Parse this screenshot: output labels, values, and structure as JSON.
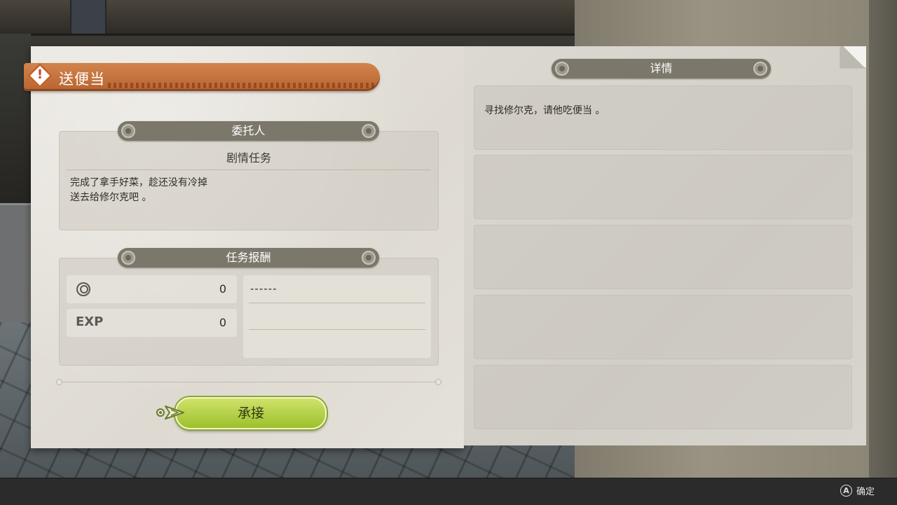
{
  "quest": {
    "title": "送便当",
    "client_header": "委托人",
    "client_name": "剧情任务",
    "description_line1": "完成了拿手好菜，趁还没有冷掉",
    "description_line2": "送去给修尔克吧 。",
    "reward_header": "任务报酬",
    "money_value": "0",
    "exp_label": "EXP",
    "exp_value": "0",
    "reward_item": "------",
    "accept_label": "承接"
  },
  "details": {
    "header": "详情",
    "rows": [
      "寻找修尔克，请他吃便当 。",
      "",
      "",
      "",
      ""
    ]
  },
  "footer": {
    "button_glyph": "A",
    "confirm_label": "确定"
  },
  "colors": {
    "banner": "#c4622a",
    "accept_button": "#b5d040",
    "section_header": "#7c776b"
  },
  "icons": {
    "warning": "warning-diamond-icon",
    "money": "coin-icon",
    "cursor": "pointer-arrow-icon"
  }
}
